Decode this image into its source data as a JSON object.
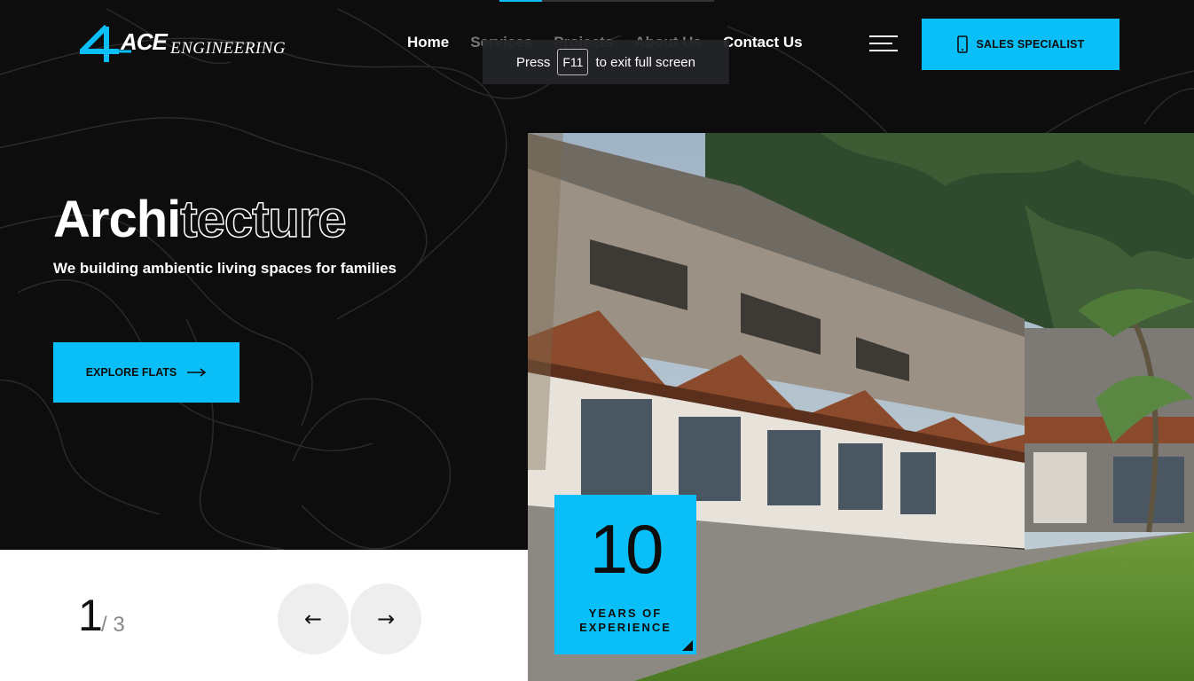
{
  "header": {
    "logo": {
      "mark": "4",
      "ace": "ACE",
      "engineering": "ENGINEERING"
    },
    "nav": [
      {
        "label": "Home",
        "dim": false
      },
      {
        "label": "Services",
        "dim": true
      },
      {
        "label": "Projects",
        "dim": true
      },
      {
        "label": "About Us",
        "dim": true
      },
      {
        "label": "Contact Us",
        "dim": false
      }
    ],
    "menu_icon": "hamburger-menu-icon",
    "sales_button": {
      "icon": "mobile-phone-icon",
      "label": "SALES SPECIALIST"
    }
  },
  "fullscreen_toast": {
    "press": "Press",
    "key": "F11",
    "rest": "to exit full screen"
  },
  "hero": {
    "title_solid": "Archi",
    "title_outline": "tecture",
    "subtitle": "We building ambientic living spaces for families",
    "explore_button": {
      "label": "EXPLORE FLATS",
      "icon": "arrow-right-icon"
    }
  },
  "slider": {
    "current": "1",
    "total": "/ 3",
    "prev_icon": "arrow-left-icon",
    "next_icon": "arrow-right-icon",
    "prev_glyph": "←",
    "next_glyph": "→"
  },
  "experience_badge": {
    "number": "10",
    "line1": "YEARS OF",
    "line2": "EXPERIENCE"
  },
  "colors": {
    "accent": "#0abff7",
    "background": "#0d0d0e",
    "panel": "#ffffff"
  }
}
